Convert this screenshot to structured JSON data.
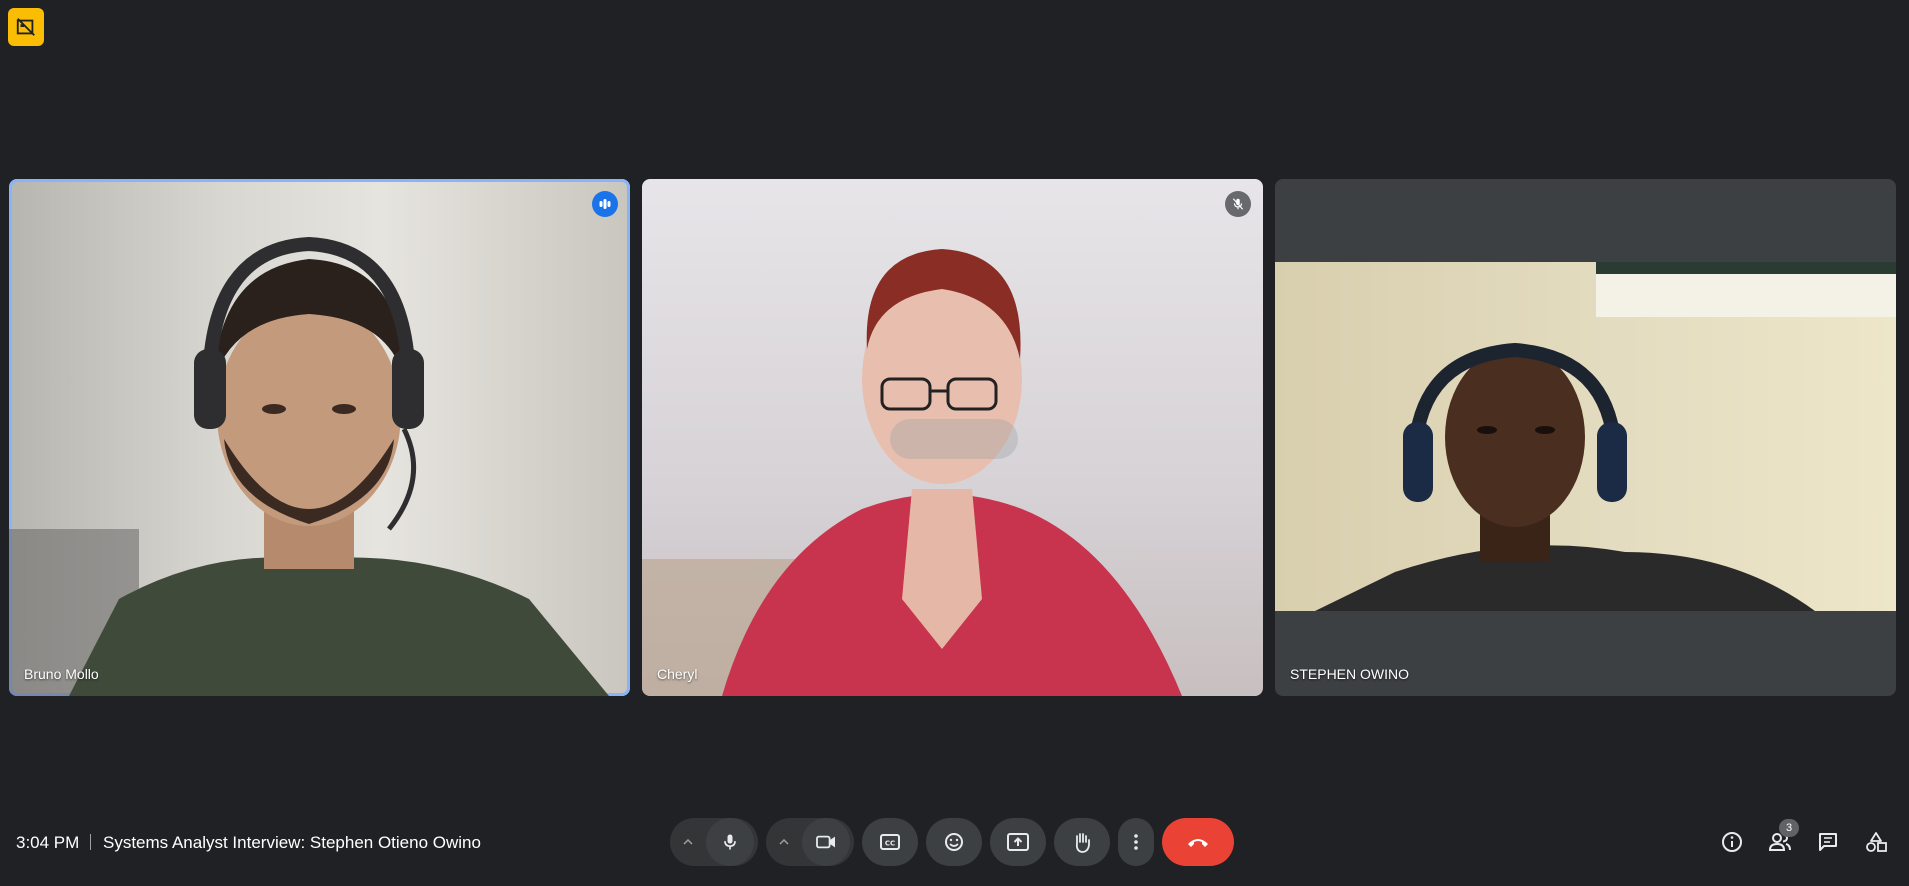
{
  "participants": [
    {
      "name": "Bruno Mollo",
      "status_icon": "speaking-indicator-icon",
      "speaking": true
    },
    {
      "name": "Cheryl",
      "status_icon": "mic-off-icon",
      "speaking": false
    },
    {
      "name": "STEPHEN OWINO",
      "status_icon": "",
      "speaking": false
    }
  ],
  "meeting": {
    "time": "3:04 PM",
    "title": "Systems Analyst Interview: Stephen Otieno Owino"
  },
  "controls": {
    "mic_icon": "mic-icon",
    "camera_icon": "camera-icon",
    "captions_icon": "captions-icon",
    "reactions_icon": "emoji-icon",
    "present_icon": "present-screen-icon",
    "raise_hand_icon": "raise-hand-icon",
    "more_icon": "more-options-icon",
    "end_call_icon": "end-call-icon"
  },
  "right_panel": {
    "info_icon": "info-icon",
    "people_icon": "people-icon",
    "people_count": "3",
    "chat_icon": "chat-icon",
    "activities_icon": "activities-icon"
  },
  "colors": {
    "background": "#202124",
    "speaking_border": "#8ab4f8",
    "end_call": "#ea4335",
    "recording_badge": "#fbbc04"
  }
}
